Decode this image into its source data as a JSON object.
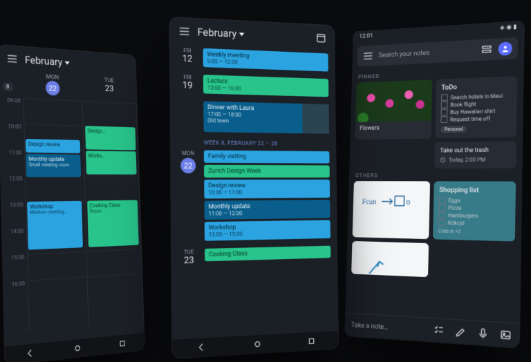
{
  "phone1": {
    "title": "February",
    "weeknum": "8",
    "days": [
      {
        "dow": "MON",
        "num": "22",
        "today": true
      },
      {
        "dow": "TUE",
        "num": "23",
        "today": false
      }
    ],
    "hours": [
      "09:00",
      "10:00",
      "11:00",
      "12:00",
      "13:00",
      "14:00",
      "15:00",
      "16:00"
    ],
    "events": [
      {
        "title": "Design review",
        "sub": "",
        "col": "b"
      },
      {
        "title": "Monthly update",
        "sub": "Small meeting room",
        "col": "d"
      },
      {
        "title": "Workshop",
        "sub": "Medium meeting…",
        "col": "b"
      },
      {
        "title": "Design…",
        "sub": "",
        "col": "g"
      },
      {
        "title": "Works…",
        "sub": "",
        "col": "g"
      },
      {
        "title": "Cooking Class",
        "sub": "Rosso",
        "col": "g"
      }
    ]
  },
  "phone2": {
    "title": "February",
    "rows": [
      {
        "dow": "FRI",
        "num": "12",
        "events": [
          {
            "title": "Weekly meeting",
            "time": "9:00 — 12:00",
            "col": "b"
          }
        ]
      },
      {
        "dow": "FRI",
        "num": "19",
        "events": [
          {
            "title": "Lecture",
            "time": "13:00 — 16:00",
            "col": "g"
          }
        ]
      },
      {
        "dow": "",
        "num": "",
        "events": [
          {
            "title": "Dinner with Laura",
            "time": "17:00 — 18:00",
            "sub": "Old town",
            "col": "db",
            "thumb": true
          }
        ]
      }
    ],
    "weekheader": "WEEK 8, FEBRUARY 22 – 28",
    "rows2": [
      {
        "dow": "MON",
        "num": "22",
        "today": true,
        "events": [
          {
            "title": "Family visiting",
            "time": "",
            "col": "b"
          },
          {
            "title": "Zurich Design Week",
            "time": "",
            "col": "g"
          },
          {
            "title": "Design review",
            "time": "10:30 — 11:00",
            "col": "b"
          },
          {
            "title": "Monthly update",
            "time": "11:00 — 12:00",
            "col": "db"
          },
          {
            "title": "Workshop",
            "time": "13:00 — 15:00",
            "col": "b"
          }
        ]
      },
      {
        "dow": "TUE",
        "num": "23",
        "events": [
          {
            "title": "Cooking Class",
            "time": "",
            "col": "g"
          }
        ]
      }
    ]
  },
  "phone3": {
    "clock": "12:01",
    "search_placeholder": "Search your notes",
    "sections": {
      "pinned": "PINNED",
      "others": "OTHERS"
    },
    "pinned": {
      "flowers_caption": "Flowers",
      "todo": {
        "title": "ToDo",
        "items": [
          "Search hotels in Maui",
          "Book flight",
          "Buy Hawaiian shirt",
          "Request time off"
        ],
        "tag": "Personal"
      },
      "trash": {
        "title": "Take out the trash",
        "reminder": "Today, 2:00 PM"
      }
    },
    "others": {
      "sketch_text": "Fcun → to",
      "shopping": {
        "title": "Shopping list",
        "items": [
          "Eggs",
          "Pizza",
          "Hamburgers",
          "Kdkcjd"
        ],
        "footer": "Cvbb   In   +3"
      }
    },
    "compose_placeholder": "Take a note…"
  }
}
